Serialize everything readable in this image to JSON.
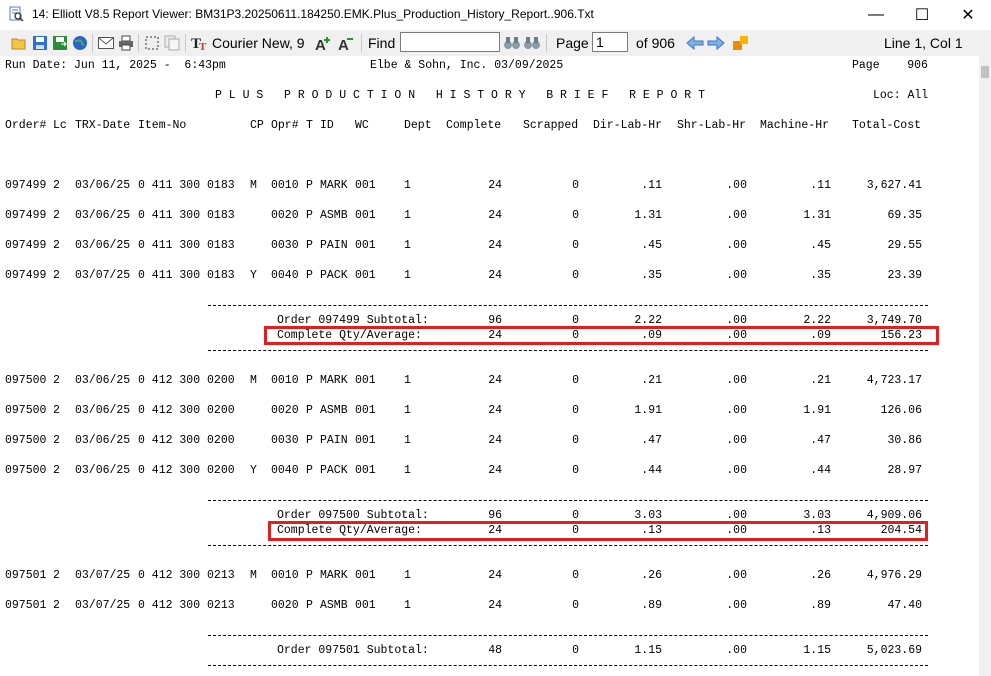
{
  "window": {
    "title": "14: Elliott V8.5 Report Viewer: BM31P3.20250611.184250.EMK.Plus_Production_History_Report..906.Txt",
    "minimize": "—",
    "maximize": "☐",
    "close": "✕"
  },
  "toolbar": {
    "font_label": "Courier New, 9",
    "find_label": "Find",
    "find_value": "",
    "page_label": "Page",
    "page_value": "1",
    "of_pages": "of 906",
    "cursor_position": "Line 1, Col 1"
  },
  "report": {
    "run_date": "Run Date: Jun 11, 2025 -  6:43pm",
    "company": "Elbe & Sohn, Inc. 03/09/2025",
    "page": "Page    906",
    "title": "P L U S   P R O D U C T I O N   H I S T O R Y   B R I E F   R E P O R T",
    "loc": "Loc: All",
    "headers": [
      "Order#",
      "Lc",
      "TRX-Date",
      "Item-No",
      "CP",
      "Opr#",
      "T",
      "ID",
      "WC",
      "Dept",
      "Complete",
      "Scrapped",
      "Dir-Lab-Hr",
      "Shr-Lab-Hr",
      "Machine-Hr",
      "Total-Cost"
    ],
    "rows": [
      {
        "order": "097499",
        "lc": "2",
        "date": "03/06/25",
        "item": "0 411 300 0183",
        "cp": "M",
        "opr": "0010",
        "t": "P",
        "id": "MARK",
        "wc": "001",
        "dept": "1",
        "complete": "24",
        "scrapped": "0",
        "dir": ".11",
        "shr": ".00",
        "mach": ".11",
        "cost": "3,627.41"
      },
      {
        "order": "097499",
        "lc": "2",
        "date": "03/06/25",
        "item": "0 411 300 0183",
        "cp": "",
        "opr": "0020",
        "t": "P",
        "id": "ASMB",
        "wc": "001",
        "dept": "1",
        "complete": "24",
        "scrapped": "0",
        "dir": "1.31",
        "shr": ".00",
        "mach": "1.31",
        "cost": "69.35"
      },
      {
        "order": "097499",
        "lc": "2",
        "date": "03/06/25",
        "item": "0 411 300 0183",
        "cp": "",
        "opr": "0030",
        "t": "P",
        "id": "PAIN",
        "wc": "001",
        "dept": "1",
        "complete": "24",
        "scrapped": "0",
        "dir": ".45",
        "shr": ".00",
        "mach": ".45",
        "cost": "29.55"
      },
      {
        "order": "097499",
        "lc": "2",
        "date": "03/07/25",
        "item": "0 411 300 0183",
        "cp": "Y",
        "opr": "0040",
        "t": "P",
        "id": "PACK",
        "wc": "001",
        "dept": "1",
        "complete": "24",
        "scrapped": "0",
        "dir": ".35",
        "shr": ".00",
        "mach": ".35",
        "cost": "23.39"
      },
      {
        "order": "097500",
        "lc": "2",
        "date": "03/06/25",
        "item": "0 412 300 0200",
        "cp": "M",
        "opr": "0010",
        "t": "P",
        "id": "MARK",
        "wc": "001",
        "dept": "1",
        "complete": "24",
        "scrapped": "0",
        "dir": ".21",
        "shr": ".00",
        "mach": ".21",
        "cost": "4,723.17"
      },
      {
        "order": "097500",
        "lc": "2",
        "date": "03/06/25",
        "item": "0 412 300 0200",
        "cp": "",
        "opr": "0020",
        "t": "P",
        "id": "ASMB",
        "wc": "001",
        "dept": "1",
        "complete": "24",
        "scrapped": "0",
        "dir": "1.91",
        "shr": ".00",
        "mach": "1.91",
        "cost": "126.06"
      },
      {
        "order": "097500",
        "lc": "2",
        "date": "03/06/25",
        "item": "0 412 300 0200",
        "cp": "",
        "opr": "0030",
        "t": "P",
        "id": "PAIN",
        "wc": "001",
        "dept": "1",
        "complete": "24",
        "scrapped": "0",
        "dir": ".47",
        "shr": ".00",
        "mach": ".47",
        "cost": "30.86"
      },
      {
        "order": "097500",
        "lc": "2",
        "date": "03/06/25",
        "item": "0 412 300 0200",
        "cp": "Y",
        "opr": "0040",
        "t": "P",
        "id": "PACK",
        "wc": "001",
        "dept": "1",
        "complete": "24",
        "scrapped": "0",
        "dir": ".44",
        "shr": ".00",
        "mach": ".44",
        "cost": "28.97"
      },
      {
        "order": "097501",
        "lc": "2",
        "date": "03/07/25",
        "item": "0 412 300 0213",
        "cp": "M",
        "opr": "0010",
        "t": "P",
        "id": "MARK",
        "wc": "001",
        "dept": "1",
        "complete": "24",
        "scrapped": "0",
        "dir": ".26",
        "shr": ".00",
        "mach": ".26",
        "cost": "4,976.29"
      },
      {
        "order": "097501",
        "lc": "2",
        "date": "03/07/25",
        "item": "0 412 300 0213",
        "cp": "",
        "opr": "0020",
        "t": "P",
        "id": "ASMB",
        "wc": "001",
        "dept": "1",
        "complete": "24",
        "scrapped": "0",
        "dir": ".89",
        "shr": ".00",
        "mach": ".89",
        "cost": "47.40"
      }
    ],
    "subtotals": [
      {
        "label": "Order 097499 Subtotal:",
        "complete": "96",
        "scrapped": "0",
        "dir": "2.22",
        "shr": ".00",
        "mach": "2.22",
        "cost": "3,749.70"
      },
      {
        "label": "Complete Qty/Average:",
        "complete": "24",
        "scrapped": "0",
        "dir": ".09",
        "shr": ".00",
        "mach": ".09",
        "cost": "156.23"
      },
      {
        "label": "Order 097500 Subtotal:",
        "complete": "96",
        "scrapped": "0",
        "dir": "3.03",
        "shr": ".00",
        "mach": "3.03",
        "cost": "4,909.06"
      },
      {
        "label": "Complete Qty/Average:",
        "complete": "24",
        "scrapped": "0",
        "dir": ".13",
        "shr": ".00",
        "mach": ".13",
        "cost": "204.54"
      },
      {
        "label": "Order 097501 Subtotal:",
        "complete": "48",
        "scrapped": "0",
        "dir": "1.15",
        "shr": ".00",
        "mach": "1.15",
        "cost": "5,023.69"
      }
    ]
  }
}
